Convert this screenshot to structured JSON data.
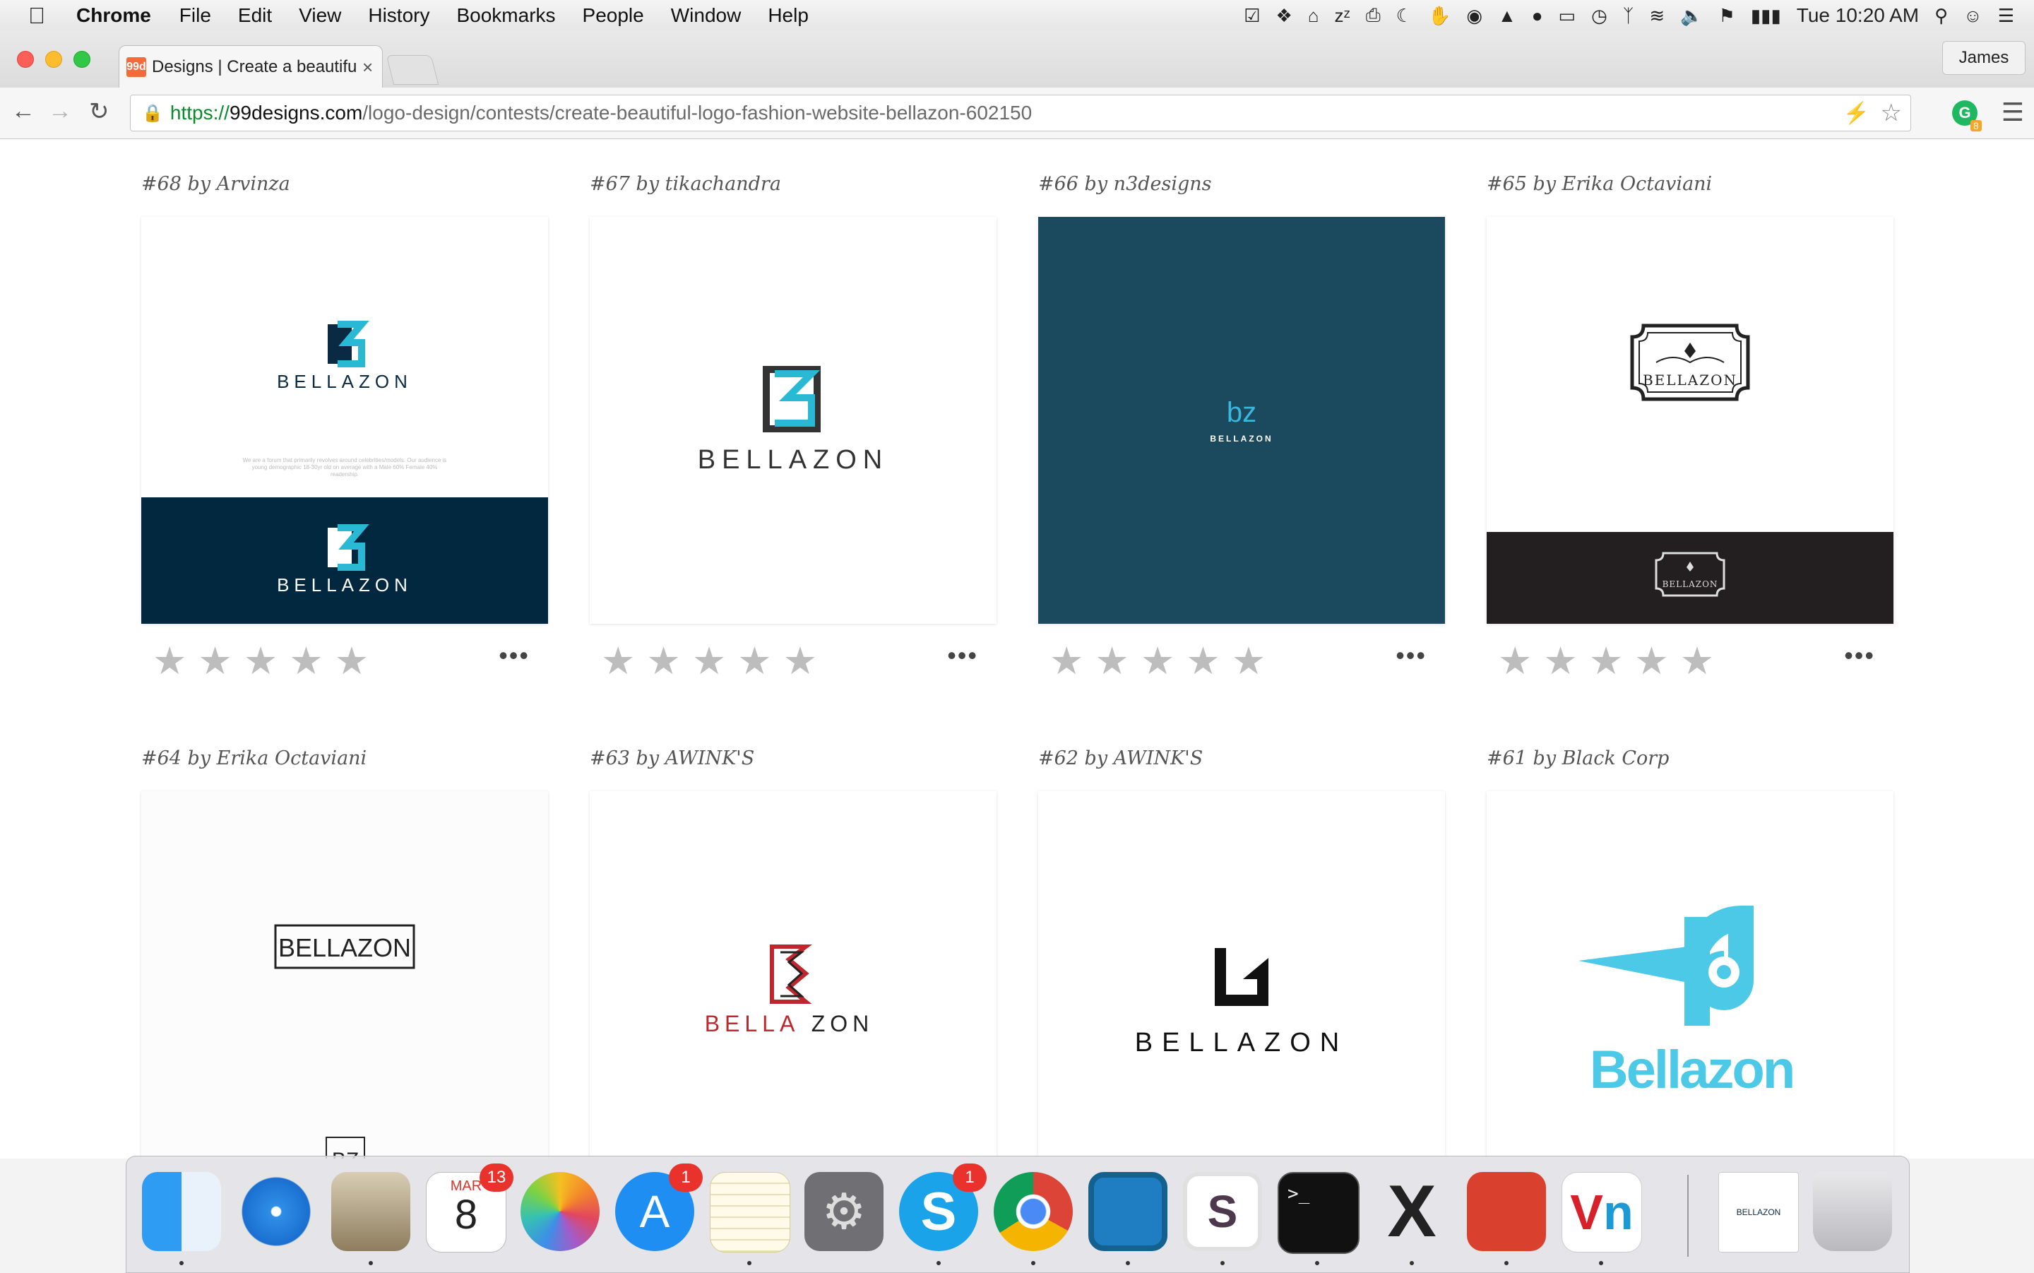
{
  "menubar": {
    "app_name": "Chrome",
    "menus": [
      "File",
      "Edit",
      "View",
      "History",
      "Bookmarks",
      "People",
      "Window",
      "Help"
    ],
    "clock": "Tue 10:20 AM"
  },
  "browser": {
    "tab_title": "Designs | Create a beautiful logo",
    "tab_favicon_text": "99d",
    "profile_name": "James",
    "url_scheme": "https://",
    "url_host": "99designs.com",
    "url_path": "/logo-design/contests/create-beautiful-logo-fashion-website-bellazon-602150",
    "extension_badge": "8"
  },
  "entries": [
    {
      "caption": "#68 by Arvinza",
      "logo_text": "BELLAZON",
      "logo_mark": "Z",
      "blurb": "We are a forum that primarily revolves around celebrities/models. Our audience is young demographic 18-30yr old on average with a Male 60% Female 40% readership."
    },
    {
      "caption": "#67 by tikachandra",
      "logo_text": "BELLAZON",
      "logo_mark": "Z"
    },
    {
      "caption": "#66 by n3designs",
      "logo_text": "BELLAZON",
      "logo_mark": "bz"
    },
    {
      "caption": "#65 by Erika Octaviani",
      "logo_text": "BELLAZON"
    },
    {
      "caption": "#64 by Erika Octaviani",
      "logo_text": "BELLAZON",
      "logo_mark": "BZ"
    },
    {
      "caption": "#63 by AWINK'S",
      "logo_text_a": "BELLA",
      "logo_text_b": "ZON"
    },
    {
      "caption": "#62 by AWINK'S",
      "logo_text": "BELLAZON"
    },
    {
      "caption": "#61 by Black Corp",
      "logo_text": "Bellazon"
    }
  ],
  "rating_stars": [
    "★",
    "★",
    "★",
    "★",
    "★"
  ],
  "more_label": "•••",
  "dock": {
    "calendar_month": "MAR",
    "calendar_day": "8",
    "calendar_badge": "13",
    "appstore_badge": "1",
    "skype_badge": "1",
    "terminal_prompt": ">_",
    "bellazon_doc_text": "BELLAZON"
  },
  "colors": {
    "navy": "#0a2a44",
    "teal": "#1b4a5e",
    "cyan": "#2ab9d4",
    "sky": "#4dc9e8",
    "red": "#c0262d",
    "dark_bar": "#231f20"
  }
}
